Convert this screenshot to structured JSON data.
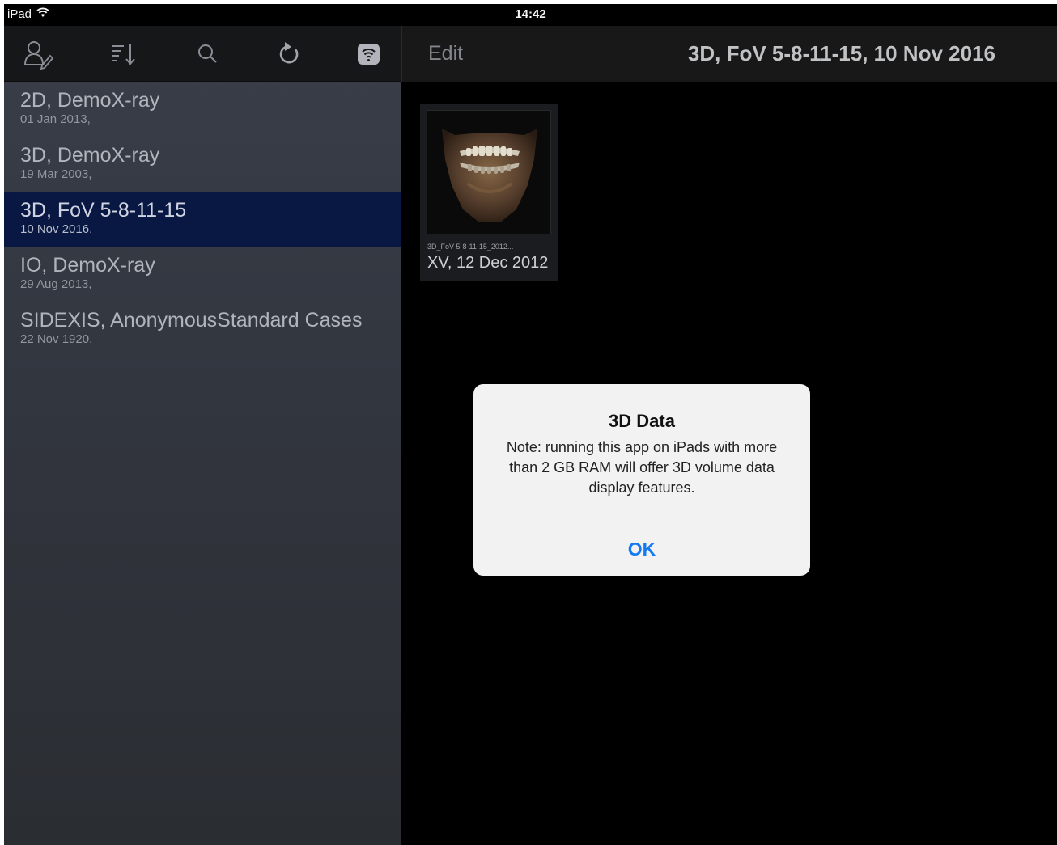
{
  "statusbar": {
    "device": "iPad",
    "time": "14:42",
    "wifi_icon": "wifi-icon"
  },
  "toolbar": {
    "icons": [
      "patient-edit-icon",
      "sort-icon",
      "search-icon",
      "refresh-icon",
      "wifi-connect-icon"
    ]
  },
  "patients": [
    {
      "name": "2D, DemoX-ray",
      "date": "01 Jan 2013,"
    },
    {
      "name": "3D, DemoX-ray",
      "date": "19 Mar 2003,"
    },
    {
      "name": "3D, FoV 5-8-11-15",
      "date": "10 Nov 2016,",
      "selected": true
    },
    {
      "name": "IO, DemoX-ray",
      "date": "29 Aug 2013,"
    },
    {
      "name": "SIDEXIS, AnonymousStandard Cases",
      "date": "22 Nov 1920,"
    }
  ],
  "navbar": {
    "edit_label": "Edit",
    "title": "3D, FoV 5-8-11-15, 10 Nov 2016"
  },
  "thumbnail": {
    "filename": "3D_FoV 5-8-11-15_2012...",
    "label": "XV, 12 Dec 2012"
  },
  "alert": {
    "title": "3D Data",
    "message": "Note: running this app on iPads with more than 2 GB RAM will offer 3D volume data display features.",
    "ok_label": "OK"
  },
  "colors": {
    "accent": "#1479f3",
    "selected_row": "#0a1a45",
    "sidebar_bg": "#3c414c"
  }
}
